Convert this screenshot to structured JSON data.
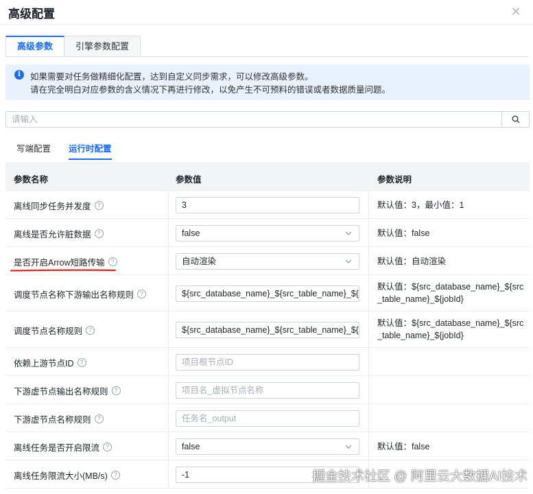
{
  "dialog": {
    "title": "高级配置"
  },
  "tabs": [
    {
      "label": "高级参数"
    },
    {
      "label": "引擎参数配置"
    }
  ],
  "notice": {
    "line1": "如果需要对任务做精细化配置，达到自定义同步需求，可以修改高级参数。",
    "line2": "请在完全明白对应参数的含义情况下再进行修改，以免产生不可预料的错误或者数据质量问题。"
  },
  "search": {
    "placeholder": "请输入"
  },
  "subtabs": [
    {
      "label": "写端配置"
    },
    {
      "label": "运行时配置"
    }
  ],
  "table": {
    "headers": {
      "name": "参数名称",
      "value": "参数值",
      "desc": "参数说明"
    },
    "rows": [
      {
        "name": "离线同步任务并发度",
        "value": "3",
        "placeholder": "",
        "type": "input",
        "desc": "默认值：3，最小值：1"
      },
      {
        "name": "离线是否允许脏数据",
        "value": "false",
        "placeholder": "",
        "type": "select",
        "desc": "默认值：false"
      },
      {
        "name": "是否开启Arrow短路传输",
        "value": "自动渲染",
        "placeholder": "",
        "type": "select",
        "desc": "默认值：自动渲染"
      },
      {
        "name": "调度节点名称下游输出名称规则",
        "value": "${src_database_name}_${src_table_name}_${",
        "placeholder": "",
        "type": "input",
        "desc": "默认值：${src_database_name}_${src_table_name}_${jobId}"
      },
      {
        "name": "调度节点名称规则",
        "value": "${src_database_name}_${src_table_name}_${",
        "placeholder": "",
        "type": "input",
        "desc": "默认值：${src_database_name}_${src_table_name}_${jobId}"
      },
      {
        "name": "依赖上游节点ID",
        "value": "",
        "placeholder": "项目根节点ID",
        "type": "input",
        "desc": ""
      },
      {
        "name": "下游虚节点输出名称规则",
        "value": "",
        "placeholder": "项目名_虚拟节点名称",
        "type": "input",
        "desc": ""
      },
      {
        "name": "下游虚节点名称规则",
        "value": "",
        "placeholder": "任务名_output",
        "type": "input",
        "desc": ""
      },
      {
        "name": "离线任务是否开启限流",
        "value": "false",
        "placeholder": "",
        "type": "select",
        "desc": "默认值：false"
      },
      {
        "name": "离线任务限流大小(MB/s)",
        "value": "-1",
        "placeholder": "",
        "type": "input",
        "desc": ""
      }
    ]
  },
  "watermark": "掘金技术社区 @ 阿里云大数据AI技术",
  "colors": {
    "accent": "#1a6df0",
    "annotation": "#e02020"
  }
}
